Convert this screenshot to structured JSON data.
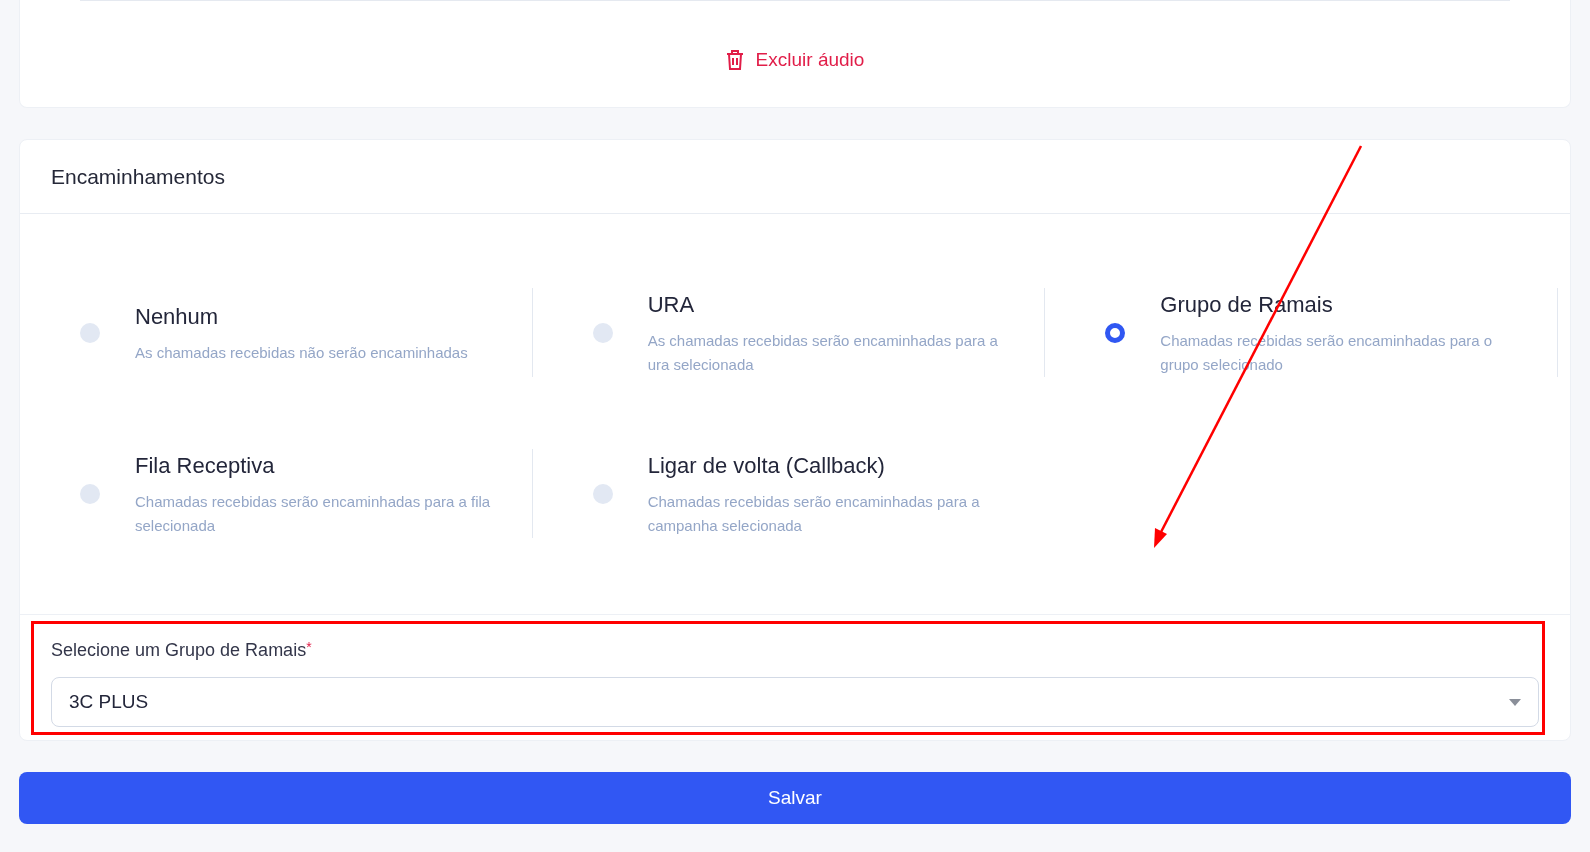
{
  "audio_card": {
    "delete_label": "Excluir áudio"
  },
  "forwarding": {
    "title": "Encaminhamentos",
    "options": [
      {
        "title": "Nenhum",
        "description": "As chamadas recebidas não serão encaminhadas",
        "selected": false
      },
      {
        "title": "URA",
        "description": "As chamadas recebidas serão encaminhadas para a ura selecionada",
        "selected": false
      },
      {
        "title": "Grupo de Ramais",
        "description": "Chamadas recebidas serão encaminhadas para o grupo selecionado",
        "selected": true
      },
      {
        "title": "Fila Receptiva",
        "description": "Chamadas recebidas serão encaminhadas para a fila selecionada",
        "selected": false
      },
      {
        "title": "Ligar de volta (Callback)",
        "description": "Chamadas recebidas serão encaminhadas para a campanha selecionada",
        "selected": false
      }
    ],
    "select": {
      "label": "Selecione um Grupo de Ramais",
      "required_mark": "*",
      "value": "3C PLUS"
    }
  },
  "save_button": "Salvar"
}
